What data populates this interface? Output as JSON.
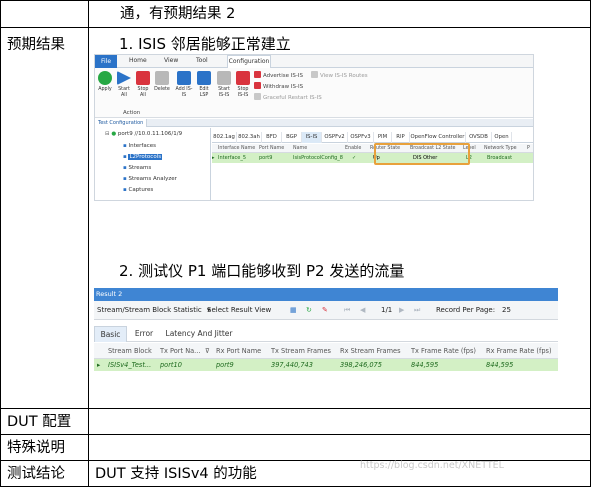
{
  "doc": {
    "row0_text": "通，有预期结果 2",
    "row1_label": "预期结果",
    "step1": "1. ISIS 邻居能够正常建立",
    "step2": "2. 测试仪 P1 端口能够收到 P2 发送的流量",
    "row2_label": "DUT 配置",
    "row3_label": "特殊说明",
    "row4_label": "测试结论",
    "row4_text": "DUT 支持 ISISv4 的功能",
    "watermark": "https://blog.csdn.net/XNETTEL"
  },
  "s1": {
    "menu": [
      "File",
      "Home",
      "View",
      "Tool",
      "Configuration"
    ],
    "ribbon_buttons": [
      {
        "label": "Apply",
        "color": "#27a844"
      },
      {
        "label": "Start All",
        "color": "#2b73c8"
      },
      {
        "label": "Stop All",
        "color": "#d9343e"
      },
      {
        "label": "Delete",
        "color": "#b8b8b8"
      },
      {
        "label": "Add IS-IS",
        "color": "#2b73c8"
      },
      {
        "label": "Edit LSP",
        "color": "#2b73c8"
      },
      {
        "label": "Start IS-IS",
        "color": "#b8b8b8"
      },
      {
        "label": "Stop IS-IS",
        "color": "#d9343e"
      }
    ],
    "group_label": "Action",
    "small_items": [
      "Advertise IS-IS",
      "Withdraw IS-IS",
      "Graceful Restart IS-IS",
      "View IS-IS Routes"
    ],
    "test_tab": "Test Configuration",
    "tree": [
      "port9 //10.0.11.106/1/9",
      "Interfaces",
      "L2Protocols",
      "Streams",
      "Streams Analyzer",
      "Captures"
    ],
    "ptabs": [
      "802.1ag",
      "802.3ah",
      "BFD",
      "BGP",
      "IS-IS",
      "OSPFv2",
      "OSPFv3",
      "PIM",
      "RIP",
      "OpenFlow Controller",
      "OVSDB",
      "Open"
    ],
    "headers": [
      "Interface Name",
      "Port Name",
      "Name",
      "Enable",
      "Router State",
      "Broadcast L2 State",
      "Level",
      "Network Type",
      "P"
    ],
    "row": [
      "Interface_5",
      "port9",
      "IsisProtocolConfig_8",
      "✓",
      "Up",
      "DIS Other",
      "L2",
      "Broadcast"
    ]
  },
  "s2": {
    "title": "Result 2",
    "tool_left": "Stream/Stream Block Statistic",
    "tool_select": "Select Result View",
    "page": "1/1",
    "rpp_label": "Record Per Page:",
    "rpp_value": "25",
    "tabs": [
      "Basic",
      "Error",
      "Latency And Jitter"
    ],
    "headers": [
      "Stream Block",
      "Tx Port Na...",
      "Rx Port Name",
      "Tx Stream Frames",
      "Rx Stream Frames",
      "Tx Frame Rate (fps)",
      "Rx Frame Rate (fps)"
    ],
    "row": [
      "ISISv4_Test...",
      "port10",
      "port9",
      "397,440,743",
      "398,246,075",
      "844,595",
      "844,595"
    ]
  }
}
